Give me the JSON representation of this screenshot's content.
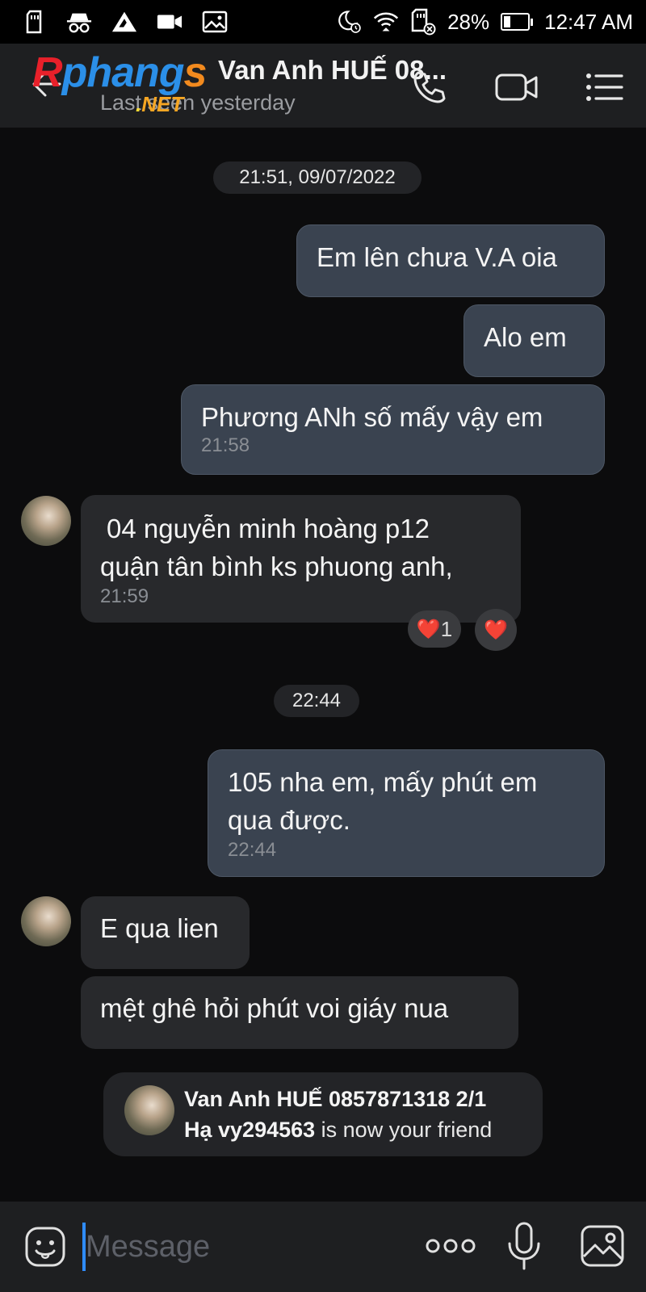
{
  "status_bar": {
    "battery": "28%",
    "battery_level": 0.28,
    "time": "12:47 AM",
    "icons": [
      "sd-card-icon",
      "incognito-icon",
      "triangle-alert-icon",
      "video-camera-icon",
      "gallery-icon",
      "moon-alarm-icon",
      "wifi-icon",
      "sd-card-blocked-icon",
      "battery-icon"
    ]
  },
  "header": {
    "logo": {
      "main_1": "R",
      "main_2": "phang",
      "main_3": "s",
      "net_dot": ".",
      "net": "NET"
    },
    "contact_name": "Van Anh HUẾ 08...",
    "last_seen": "Last seen yesterday",
    "icons": [
      "back-arrow-icon",
      "phone-icon",
      "video-call-icon",
      "menu-icon"
    ]
  },
  "chat": {
    "divider_1": "21:51, 09/07/2022",
    "msg_1": "Em lên chưa V.A oia",
    "msg_2": "Alo em",
    "msg_3": "Phương ANh số mấy vậy em",
    "msg_3_time": "21:58",
    "msg_4_line1": "04 nguyễn minh hoàng p12",
    "msg_4_line2": "quận tân bình ks phuong anh,",
    "msg_4_time": "21:59",
    "reaction_heart": "❤️",
    "reaction_count": "1",
    "divider_2": "22:44",
    "msg_5_line1": "105 nha em, mấy phút em",
    "msg_5_line2": "qua được.",
    "msg_5_time": "22:44",
    "msg_6": "E qua lien",
    "msg_7": "mệt ghê hỏi phút voi giáy nua",
    "notice_name_line1": "Van Anh HUẾ 0857871318 2/1",
    "notice_name_line2": "Hạ vy294563",
    "notice_suffix": " is now your friend"
  },
  "input_bar": {
    "placeholder": "Message",
    "icons": [
      "emoji-icon",
      "more-dots-icon",
      "microphone-icon",
      "image-icon"
    ]
  },
  "colors": {
    "background": "#0c0c0d",
    "header": "#1e1f21",
    "outgoing_bubble": "#3a4350",
    "incoming_bubble": "#28292c",
    "cursor": "#2f8cff"
  }
}
